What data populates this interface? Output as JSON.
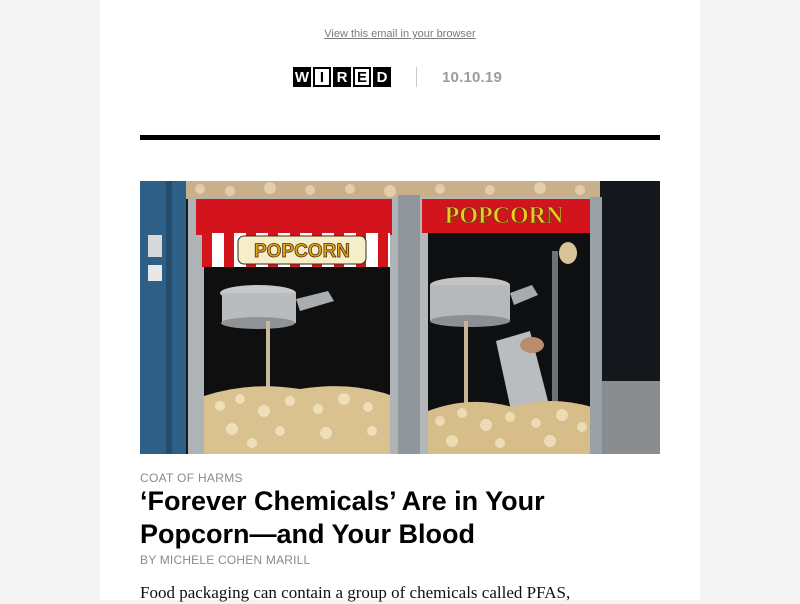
{
  "header": {
    "view_in_browser": "View this email in your browser",
    "logo_letters": [
      "W",
      "I",
      "R",
      "E",
      "D"
    ],
    "date": "10.10.19"
  },
  "hero": {
    "sign_left": "POPCORN",
    "sign_right": "POPCORN"
  },
  "article": {
    "kicker": "COAT OF HARMS",
    "headline": "‘Forever Chemicals’ Are in Your Popcorn—and Your Blood",
    "byline": "BY MICHELE COHEN MARILL",
    "dek": "Food packaging can contain a group of chemicals called PFAS,"
  },
  "colors": {
    "background": "#f4f4f4",
    "rule": "#000000",
    "meta_gray": "#8a8a8a",
    "sign_red": "#d4141c",
    "sign_yellow": "#f3c623"
  }
}
